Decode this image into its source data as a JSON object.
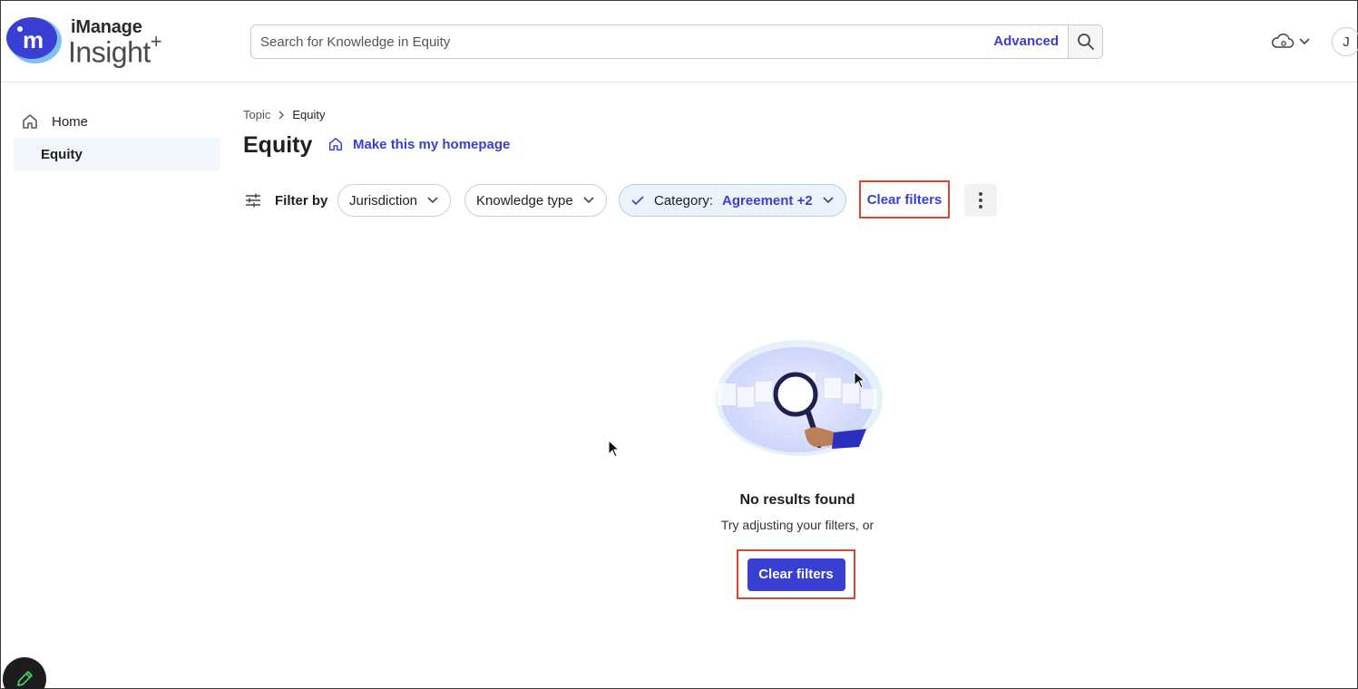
{
  "brand": {
    "name_top": "iManage",
    "name_bottom": "Insight",
    "name_suffix": "+",
    "logo_icon": "imanage-logo-icon",
    "logo_letter": "m",
    "colors": {
      "logo_blue": "#3a3fd4",
      "logo_light": "#7fc2f0"
    }
  },
  "search": {
    "placeholder": "Search for Knowledge in Equity",
    "value": "",
    "advanced_label": "Advanced",
    "search_icon": "search-icon"
  },
  "header": {
    "cloud_icon": "cloud-settings-icon",
    "dropdown_icon": "chevron-down-icon",
    "user_initial": "J"
  },
  "sidebar": {
    "items": [
      {
        "label": "Home",
        "icon": "home-icon",
        "active": false
      },
      {
        "label": "Equity",
        "active": true
      }
    ]
  },
  "breadcrumb": {
    "items": [
      "Topic",
      "Equity"
    ],
    "separator_icon": "chevron-right-icon"
  },
  "page": {
    "title": "Equity",
    "homepage_link": "Make this my homepage",
    "homepage_icon": "home-icon"
  },
  "filters": {
    "label": "Filter by",
    "filter_icon": "sliders-icon",
    "chips": [
      {
        "label": "Jurisdiction",
        "active": false
      },
      {
        "label": "Knowledge type",
        "active": false
      },
      {
        "label": "Category:",
        "value": "Agreement +2",
        "active": true
      }
    ],
    "clear_label": "Clear filters",
    "more_icon": "more-vertical-icon"
  },
  "empty_state": {
    "illustration": "magnifying-glass-illustration",
    "title": "No results found",
    "subtitle": "Try adjusting your filters, or",
    "button_label": "Clear filters"
  },
  "fab": {
    "icon": "pencil-icon"
  },
  "colors": {
    "accent": "#3a3fd4",
    "highlight_border": "#d9462e",
    "active_nav_bg": "#f0f6fb",
    "active_chip_bg": "#eaf3fb"
  }
}
